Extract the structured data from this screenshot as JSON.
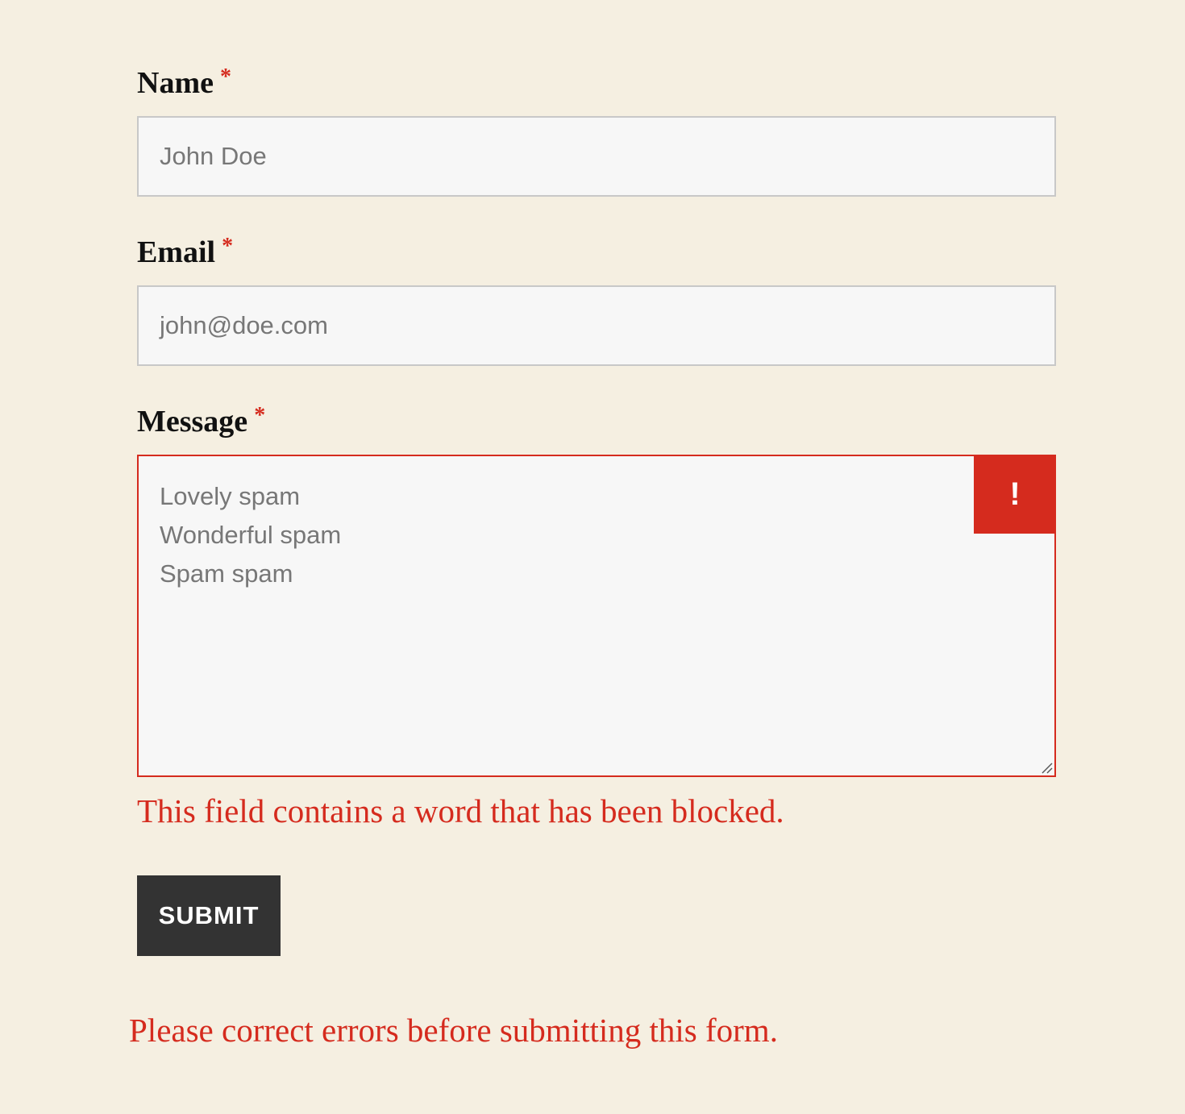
{
  "form": {
    "name": {
      "label": "Name",
      "required_mark": "*",
      "value": "John Doe"
    },
    "email": {
      "label": "Email",
      "required_mark": "*",
      "value": "john@doe.com"
    },
    "message": {
      "label": "Message",
      "required_mark": "*",
      "lines": [
        "Lovely spam",
        "Wonderful spam",
        "Spam spam"
      ],
      "error_icon": "!",
      "error": "This field contains a word that has been blocked."
    },
    "submit_label": "SUBMIT",
    "form_error": "Please correct errors before submitting this form."
  },
  "colors": {
    "background": "#f5efe1",
    "error": "#d52b1e",
    "button": "#333333",
    "input_background": "#f7f7f7",
    "input_border": "#c8c8c8"
  },
  "icons": {
    "error_badge": "exclamation-icon",
    "resize": "resize-grip-icon"
  }
}
